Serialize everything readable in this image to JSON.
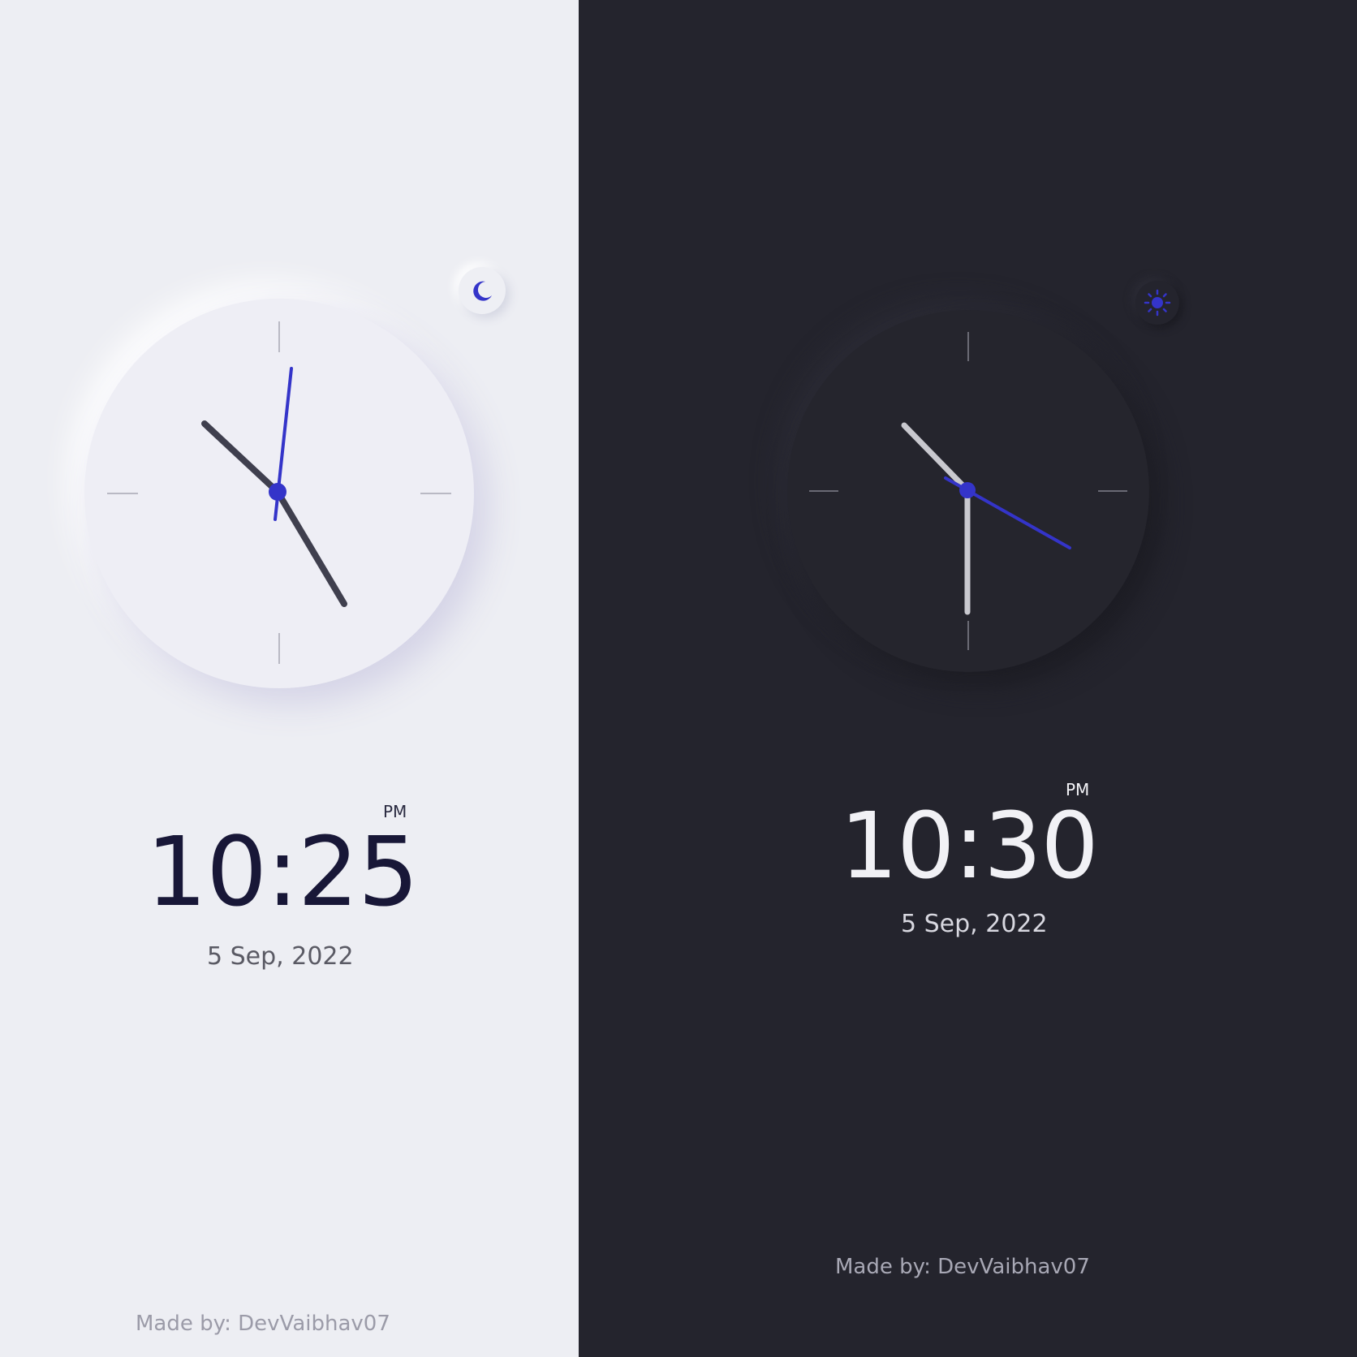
{
  "light": {
    "time": "10:25",
    "period": "PM",
    "date": "5 Sep, 2022",
    "credit": "Made by: DevVaibhav07",
    "toggle_icon": "moon-icon",
    "colors": {
      "background": "#edeef3",
      "accent": "#3434c9",
      "hand": "#3f3f4e",
      "text": "#181737"
    }
  },
  "dark": {
    "time": "10:30",
    "period": "PM",
    "date": "5 Sep, 2022",
    "credit": "Made by: DevVaibhav07",
    "toggle_icon": "sun-icon",
    "colors": {
      "background": "#24242d",
      "accent": "#3434c9",
      "hand": "#c9c9cf",
      "text": "#f1f1f5"
    }
  }
}
